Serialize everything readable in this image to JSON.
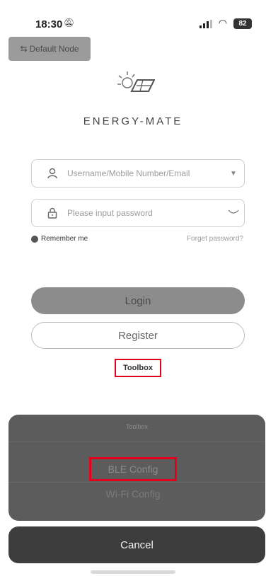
{
  "statusbar": {
    "time": "18:30",
    "battery": "82"
  },
  "header": {
    "default_node": "Default Node"
  },
  "brand": {
    "name": "ENERGY-MATE"
  },
  "form": {
    "username_placeholder": "Username/Mobile Number/Email",
    "password_placeholder": "Please input password",
    "remember_label": "Remember me",
    "forgot_label": "Forget password?"
  },
  "buttons": {
    "login": "Login",
    "register": "Register",
    "toolbox": "Toolbox"
  },
  "sheet": {
    "title": "Toolbox",
    "options": [
      "BLE Config",
      "Wi-Fi Config"
    ],
    "cancel": "Cancel"
  },
  "highlight_color": "#e2001a"
}
